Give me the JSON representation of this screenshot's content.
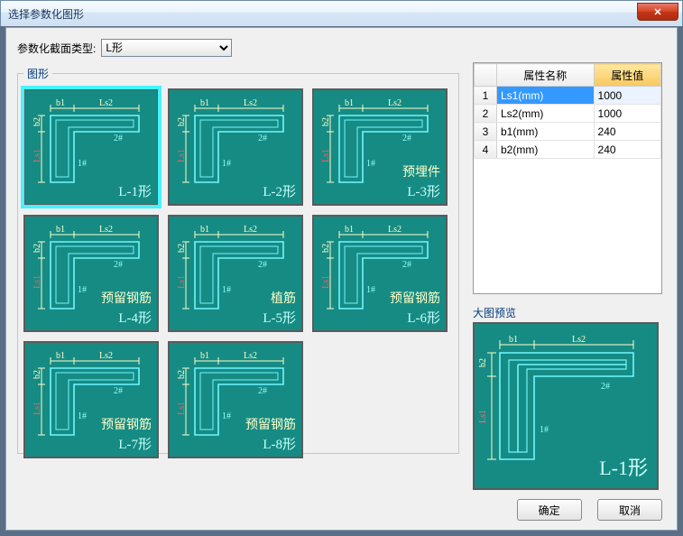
{
  "window": {
    "title": "选择参数化图形"
  },
  "close_glyph": "✕",
  "section_type": {
    "label": "参数化截面类型:",
    "value": "L形"
  },
  "shapes": {
    "legend": "图形",
    "items": [
      {
        "caption": "L-1形",
        "sub": "",
        "selected": true
      },
      {
        "caption": "L-2形",
        "sub": "",
        "selected": false
      },
      {
        "caption": "L-3形",
        "sub": "预埋件",
        "selected": false
      },
      {
        "caption": "L-4形",
        "sub": "预留钢筋",
        "selected": false
      },
      {
        "caption": "L-5形",
        "sub": "植筋",
        "selected": false
      },
      {
        "caption": "L-6形",
        "sub": "预留钢筋",
        "selected": false
      },
      {
        "caption": "L-7形",
        "sub": "预留钢筋",
        "selected": false
      },
      {
        "caption": "L-8形",
        "sub": "预留钢筋",
        "selected": false
      }
    ]
  },
  "props": {
    "headers": {
      "name": "属性名称",
      "value": "属性值"
    },
    "rows": [
      {
        "idx": "1",
        "name": "Ls1(mm)",
        "value": "1000",
        "selected": true
      },
      {
        "idx": "2",
        "name": "Ls2(mm)",
        "value": "1000",
        "selected": false
      },
      {
        "idx": "3",
        "name": "b1(mm)",
        "value": "240",
        "selected": false
      },
      {
        "idx": "4",
        "name": "b2(mm)",
        "value": "240",
        "selected": false
      }
    ]
  },
  "preview": {
    "label": "大图预览",
    "caption": "L-1形"
  },
  "buttons": {
    "ok": "确定",
    "cancel": "取消"
  },
  "dims": {
    "b1": "b1",
    "Ls2": "Ls2",
    "b2": "b2",
    "Ls1": "Ls1",
    "tag1": "1#",
    "tag2": "2#"
  }
}
